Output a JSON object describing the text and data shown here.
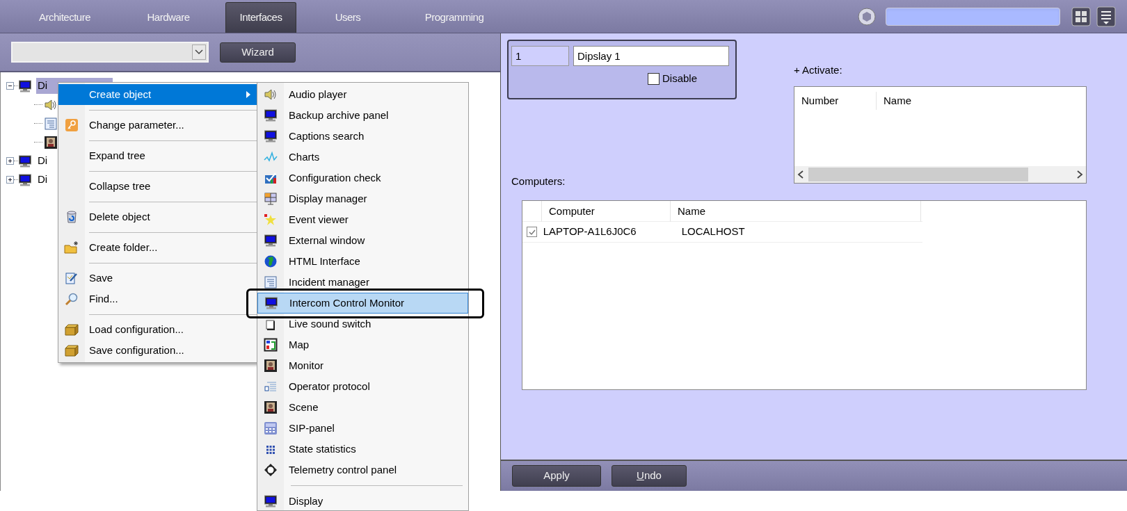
{
  "top_tabs": [
    {
      "label": "Architecture",
      "selected": false
    },
    {
      "label": "Hardware",
      "selected": false
    },
    {
      "label": "Interfaces",
      "selected": true
    },
    {
      "label": "Users",
      "selected": false
    },
    {
      "label": "Programming",
      "selected": false
    }
  ],
  "toolbar": {
    "wizard_button": "Wizard"
  },
  "tree": [
    {
      "label": "Di",
      "selected": true,
      "expanded": true,
      "children": [
        {
          "kind": "speaker"
        },
        {
          "kind": "list"
        },
        {
          "kind": "picture"
        }
      ]
    },
    {
      "label": "Di",
      "selected": false,
      "expanded": false
    },
    {
      "label": "Di",
      "selected": false,
      "expanded": false
    }
  ],
  "context_menu": {
    "groups": [
      [
        {
          "label": "Create object",
          "selected": true,
          "submenu": true
        }
      ],
      [
        {
          "label": "Change parameter...",
          "selected": false,
          "submenu": false
        }
      ],
      [
        {
          "label": "Expand tree",
          "selected": false,
          "submenu": false
        }
      ],
      [
        {
          "label": "Collapse tree",
          "selected": false,
          "submenu": false
        }
      ],
      [
        {
          "label": "Delete object",
          "selected": false,
          "submenu": false
        }
      ],
      [
        {
          "label": "Create folder...",
          "selected": false,
          "submenu": false
        }
      ],
      [
        {
          "label": "Save",
          "selected": false,
          "submenu": false
        },
        {
          "label": "Find...",
          "selected": false,
          "submenu": false
        }
      ],
      [
        {
          "label": "Load configuration...",
          "selected": false,
          "submenu": false
        },
        {
          "label": "Save configuration...",
          "selected": false,
          "submenu": false
        }
      ]
    ]
  },
  "submenu": {
    "groups": [
      [
        {
          "label": "Audio player",
          "selected": false
        },
        {
          "label": "Backup archive panel",
          "selected": false
        },
        {
          "label": "Captions search",
          "selected": false
        },
        {
          "label": "Charts",
          "selected": false
        },
        {
          "label": "Configuration check",
          "selected": false
        },
        {
          "label": "Display manager",
          "selected": false
        },
        {
          "label": "Event viewer",
          "selected": false
        },
        {
          "label": "External window",
          "selected": false
        },
        {
          "label": "HTML Interface",
          "selected": false
        },
        {
          "label": "Incident manager",
          "selected": false
        },
        {
          "label": "Intercom Control Monitor",
          "selected": true
        },
        {
          "label": "Live sound switch",
          "selected": false
        },
        {
          "label": "Map",
          "selected": false
        },
        {
          "label": "Monitor",
          "selected": false
        },
        {
          "label": "Operator protocol",
          "selected": false
        },
        {
          "label": "Scene",
          "selected": false
        },
        {
          "label": "SIP-panel",
          "selected": false
        },
        {
          "label": "State statistics",
          "selected": false
        },
        {
          "label": "Telemetry control panel",
          "selected": false
        }
      ],
      [
        {
          "label": "Display",
          "selected": false
        }
      ]
    ]
  },
  "properties": {
    "number": "1",
    "name": "Dipslay 1",
    "disable": {
      "label": "Disable",
      "checked": false
    },
    "activate": {
      "label": "+ Activate:",
      "columns": [
        "Number",
        "Name"
      ]
    },
    "computers": {
      "label": "Computers:",
      "columns": [
        "Computer",
        "Name"
      ],
      "rows": [
        {
          "checked": true,
          "computer": "LAPTOP-A1L6J0C6",
          "name": "LOCALHOST"
        }
      ]
    }
  },
  "buttons": [
    {
      "label": "Apply",
      "underline_first": false
    },
    {
      "label": "Undo",
      "underline_first": true
    }
  ]
}
